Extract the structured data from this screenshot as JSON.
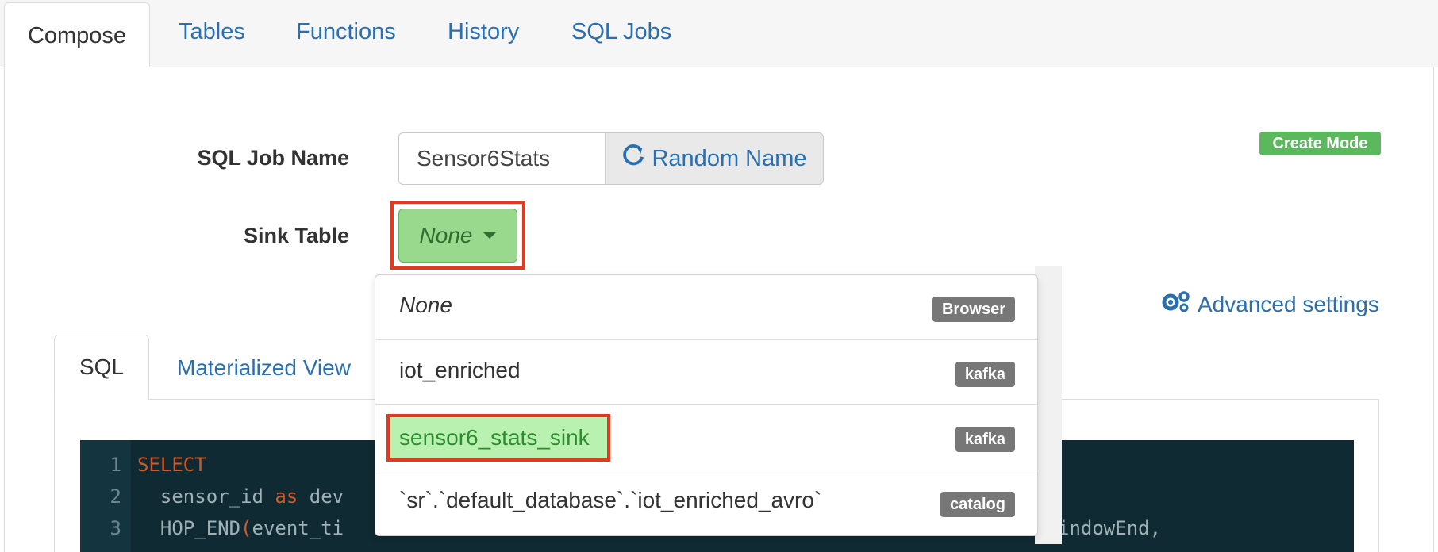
{
  "top_tabs": [
    "Compose",
    "Tables",
    "Functions",
    "History",
    "SQL Jobs"
  ],
  "form": {
    "job_name_label": "SQL Job Name",
    "job_name_value": "Sensor6Stats",
    "random_name_label": "Random Name",
    "mode_badge": "Create Mode",
    "sink_table_label": "Sink Table",
    "sink_table_value": "None",
    "advanced_settings_label": "Advanced settings"
  },
  "sub_tabs": [
    "SQL",
    "Materialized View"
  ],
  "dropdown": {
    "items": [
      {
        "label": "None",
        "badge": "Browser"
      },
      {
        "label": "iot_enriched",
        "badge": "kafka"
      },
      {
        "label": "sensor6_stats_sink",
        "badge": "kafka"
      },
      {
        "label": "`sr`.`default_database`.`iot_enriched_avro`",
        "badge": "catalog"
      }
    ]
  },
  "editor": {
    "line_numbers": [
      "1",
      "2",
      "3"
    ],
    "line1_kw": "SELECT",
    "line2_a": "  sensor_id ",
    "line2_kw": "as",
    "line2_b": " dev",
    "line3_a": "  HOP_END",
    "line3_paren": "(",
    "line3_b": "event_ti",
    "line3_tail": "indowEnd,"
  },
  "colors": {
    "link": "#2a6fb0",
    "success": "#5cb85c",
    "highlight_border": "#e5391f",
    "editor_bg": "#0f2a33",
    "keyword": "#d15a2a"
  }
}
